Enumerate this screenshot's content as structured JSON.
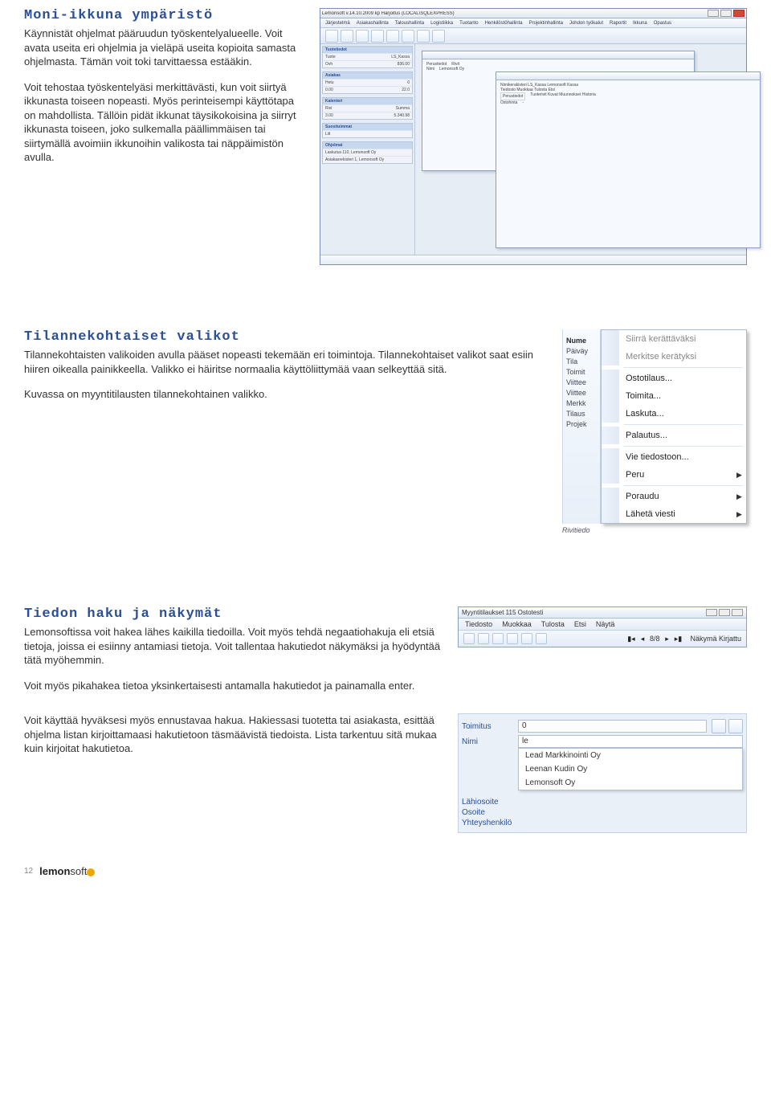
{
  "section1": {
    "heading": "Moni-ikkuna ympäristö",
    "p1": "Käynnistät ohjelmat pääruudun työskentelyalueelle. Voit avata useita eri ohjelmia ja vieläpä useita kopioita samasta ohjelmasta. Tämän voit toki tarvittaessa estääkin.",
    "p2": "Voit tehostaa työskentelyäsi merkittävästi, kun voit siirtyä ikkunasta toiseen nopeasti. Myös perinteisempi käyttötapa on mahdollista. Tällöin pidät ikkunat täysikokoisina ja siirryt ikkunasta toiseen, joko sulkemalla päällimmäisen tai siirtymällä avoimiin ikkunoihin valikosta tai näppäimistön avulla."
  },
  "section2": {
    "heading": "Tilannekohtaiset valikot",
    "p1": "Tilannekohtaisten valikoiden avulla pääset nopeasti tekemään eri toimintoja. Tilannekohtaiset valikot saat esiin hiiren oikealla painikkeella. Valikko ei häiritse normaalia käyttöliittymää vaan selkeyttää sitä.",
    "p2": "Kuvassa on myyntitilausten tilannekohtainen valikko."
  },
  "section3": {
    "heading": "Tiedon haku ja näkymät",
    "p1": "Lemonsoftissa voit hakea lähes kaikilla tiedoilla. Voit myös tehdä negaatiohakuja eli etsiä tietoja, joissa ei esiinny antamiasi tietoja. Voit tallentaa hakutiedot näkymäksi ja hyödyntää tätä myöhemmin.",
    "p2": "Voit myös pikahakea tietoa yksinkertaisesti antamalla hakutiedot ja painamalla enter.",
    "p3": "Voit käyttää hyväksesi myös ennustavaa hakua. Hakiessasi tuotetta tai asiakasta, esittää ohjelma listan kirjoittamaasi hakutietoon täsmäävistä tiedoista. Lista tarkentuu sitä mukaa kuin kirjoitat hakutietoa."
  },
  "app": {
    "title": "Lemonsoft v.14.10.2009 kp Harjoitus (LOCAL\\SQLEXPRESS)",
    "menus": [
      "Järjestelmä",
      "Asiakashallinta",
      "Taloushallinta",
      "Logistiikka",
      "Tuotanto",
      "Henkilöstöhallinta",
      "Projektinhallinta",
      "Johdon työkalut",
      "Raportit",
      "Ikkuna",
      "Opastus"
    ]
  },
  "contextmenu": {
    "left_header": "Nume",
    "left_items": [
      "Päiväy",
      "Tila",
      "Toimit",
      "Viittee",
      "Viittee",
      "Merkk",
      "Tilaus",
      "Projek"
    ],
    "left_footer": "Rivitiedo",
    "items": [
      {
        "label": "Siirrä kerättäväksi",
        "grey": true,
        "arrow": false
      },
      {
        "label": "Merkitse kerätyksi",
        "grey": true,
        "arrow": false
      },
      {
        "sep": true
      },
      {
        "label": "Ostotilaus...",
        "grey": false,
        "arrow": false
      },
      {
        "label": "Toimita...",
        "grey": false,
        "arrow": false
      },
      {
        "label": "Laskuta...",
        "grey": false,
        "arrow": false
      },
      {
        "sep": true
      },
      {
        "label": "Palautus...",
        "grey": false,
        "arrow": false
      },
      {
        "sep": true
      },
      {
        "label": "Vie tiedostoon...",
        "grey": false,
        "arrow": false
      },
      {
        "label": "Peru",
        "grey": false,
        "arrow": true
      },
      {
        "sep": true
      },
      {
        "label": "Poraudu",
        "grey": false,
        "arrow": true
      },
      {
        "label": "Lähetä viesti",
        "grey": false,
        "arrow": true
      }
    ]
  },
  "searchwin": {
    "title": "Myyntitilaukset 115 Ostotesti",
    "menus": [
      "Tiedosto",
      "Muokkaa",
      "Tulosta",
      "Etsi",
      "Näytä"
    ],
    "pager": "8/8",
    "right": "Näkymä  Kirjattu"
  },
  "autocomplete": {
    "field1_label": "Toimitus",
    "field1_value": "0",
    "field2_label": "Nimi",
    "field2_value": "le",
    "suggestions": [
      "Lead Markkinointi Oy",
      "Leenan Kudin Oy",
      "Lemonsoft Oy"
    ],
    "field3_label": "Lähiosoite",
    "field4_label": "Osoite",
    "field5_label": "Yhteyshenkilö"
  },
  "footer": {
    "page": "12",
    "brand": "lemonsoft"
  }
}
